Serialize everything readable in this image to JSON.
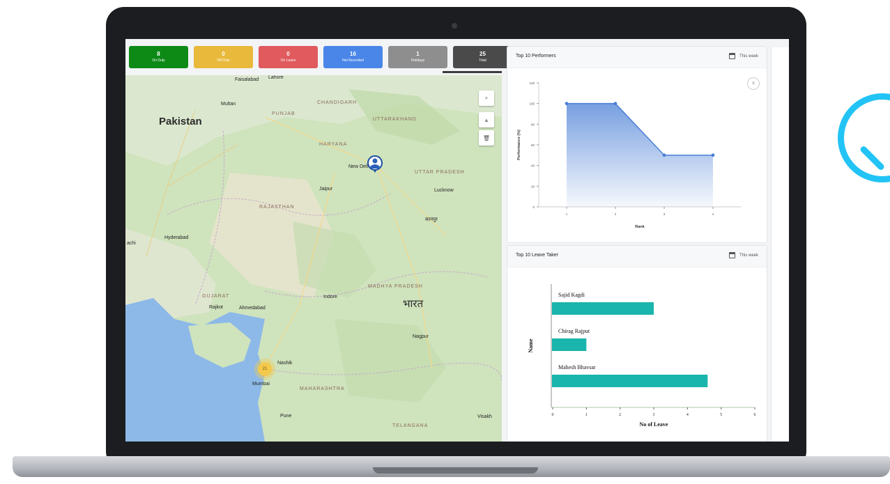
{
  "status_cards": [
    {
      "count": "8",
      "label": "On Duty",
      "color": "#0d8a16"
    },
    {
      "count": "0",
      "label": "Off Duty",
      "color": "#e8b93a"
    },
    {
      "count": "0",
      "label": "On Leave",
      "color": "#e05a5e"
    },
    {
      "count": "16",
      "label": "Not Recorded",
      "color": "#4a86e8"
    },
    {
      "count": "1",
      "label": "Holidays",
      "color": "#8e8e8e"
    },
    {
      "count": "25",
      "label": "Total",
      "color": "#4a4a4a"
    }
  ],
  "map": {
    "country_labels": {
      "pakistan": "Pakistan",
      "bharat": "भारत"
    },
    "state_labels": {
      "rajasthan": "RAJASTHAN",
      "gujarat": "GUJARAT",
      "haryana": "HARYANA",
      "uttar_pradesh": "UTTAR PRADESH",
      "madhya_pradesh": "MADHYA PRADESH",
      "maharashtra": "MAHARASHTRA",
      "telangana": "TELANGANA",
      "chandigarh": "CHANDIGARH",
      "uttarakhand": "UTTARAKHAND",
      "punjab": "PUNJAB"
    },
    "city_labels": {
      "faisalabad": "Faisalabad",
      "lahore": "Lahore",
      "multan": "Multan",
      "hyderabad": "Hyderabad",
      "jaipur": "Jaipur",
      "new_delhi": "New Delhi",
      "lucknow": "Lucknow",
      "kanpur": "कानपुर",
      "indore": "Indore",
      "rajkot": "Rajkot",
      "ahmedabad": "Ahmedabad",
      "nashik": "Nashik",
      "mumbai": "Mumbai",
      "pune": "Pune",
      "nagpur": "Nagpur",
      "visakha": "Visakh",
      "achi": "achi"
    },
    "cluster_count": "21",
    "controls": {
      "search": "⌕",
      "up": "▲",
      "trash": "🗑"
    }
  },
  "performers": {
    "title": "Top 10 Performers",
    "range": "This week",
    "chart_data": {
      "type": "area",
      "x": [
        1,
        2,
        3,
        4
      ],
      "y": [
        100,
        100,
        50,
        50
      ],
      "xlabel": "Rank",
      "ylabel": "Performance (%)",
      "ylim": [
        0,
        120
      ],
      "yticks": [
        "0",
        "20",
        "40",
        "60",
        "80",
        "100",
        "120"
      ],
      "xticks": [
        "1",
        "2",
        "3",
        "4"
      ],
      "color": "#4a7fd6"
    }
  },
  "leave": {
    "title": "Top 10 Leave Taker",
    "range": "This week",
    "chart_data": {
      "type": "bar",
      "categories": [
        "Sajid Kagdi",
        "Chirag Rajput",
        "Mahesh Bhavsar"
      ],
      "values": [
        3,
        1,
        4.6
      ],
      "xlabel": "No of Leave",
      "ylabel": "Name",
      "xlim": [
        0,
        6
      ],
      "xticks": [
        "0",
        "1",
        "2",
        "3",
        "4",
        "5",
        "6"
      ],
      "color": "#1ab5ac"
    }
  }
}
